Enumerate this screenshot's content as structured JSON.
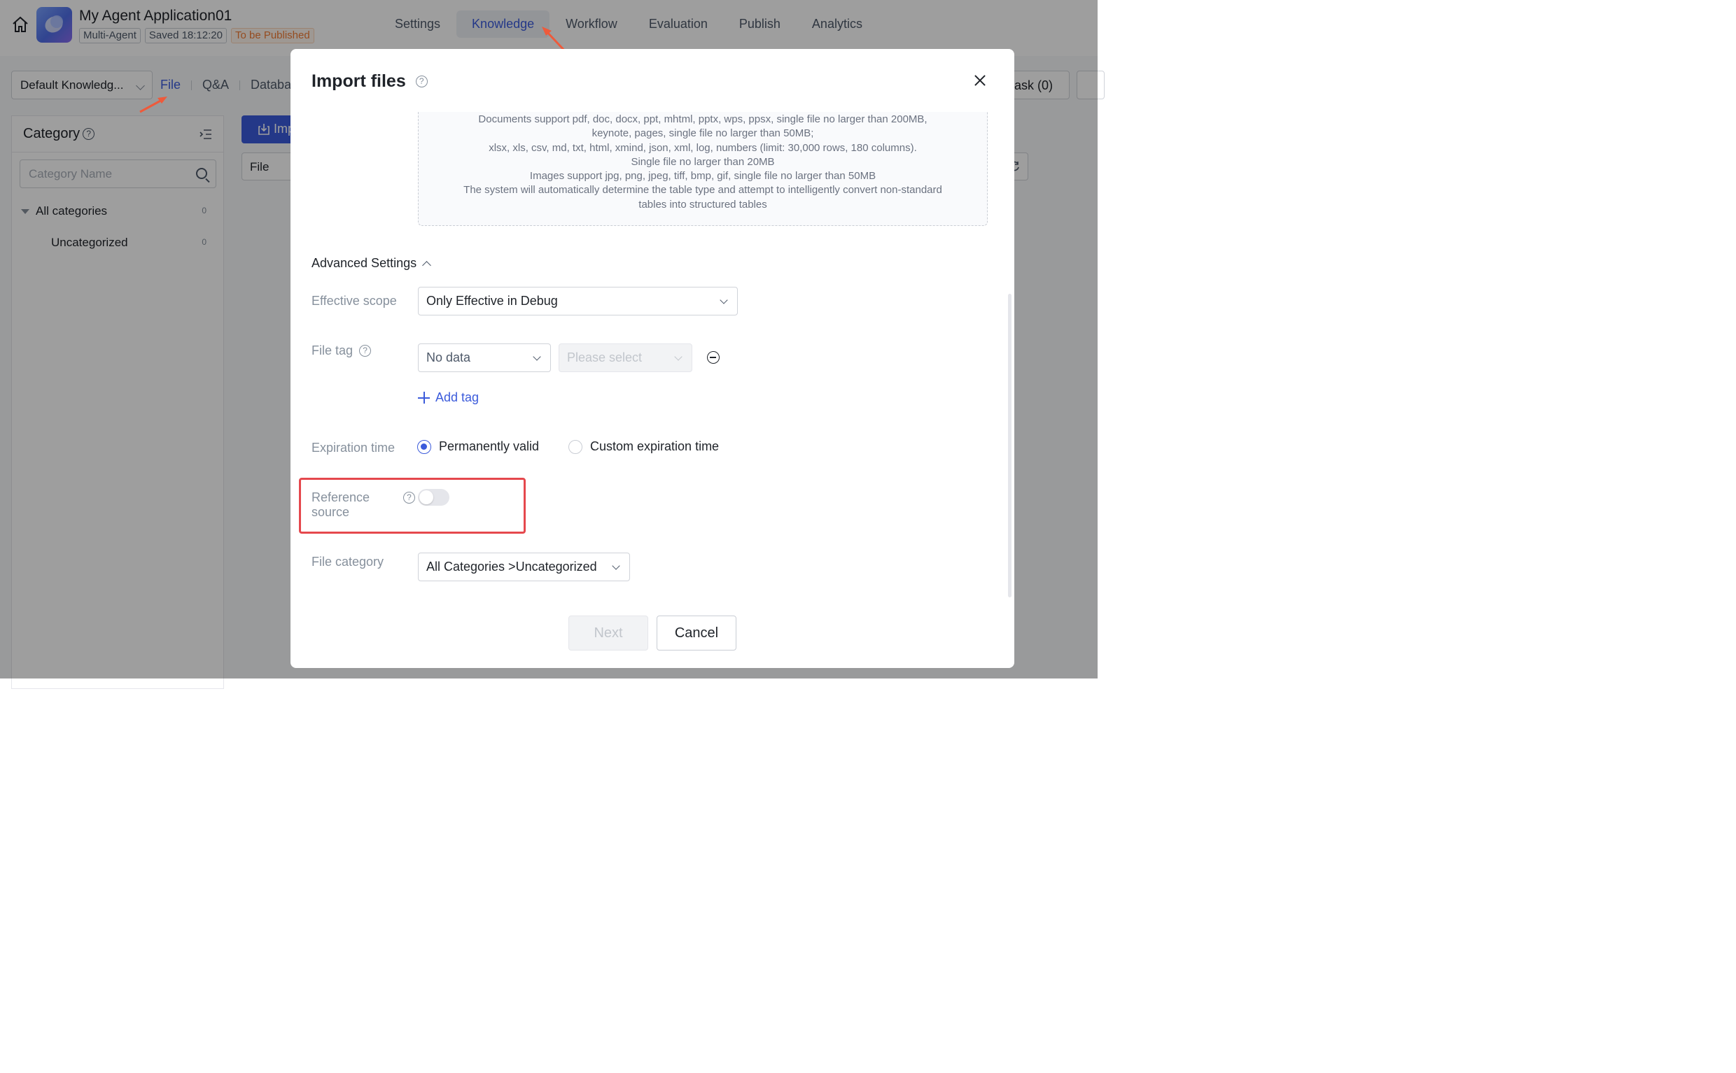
{
  "header": {
    "app_title": "My Agent Application01",
    "tags": [
      "Multi-Agent",
      "Saved 18:12:20",
      "To be Published"
    ],
    "nav": [
      "Settings",
      "Knowledge",
      "Workflow",
      "Evaluation",
      "Publish",
      "Analytics"
    ],
    "active_nav": "Knowledge"
  },
  "kb_bar": {
    "selector_value": "Default Knowledg...",
    "tabs": [
      "File",
      "Q&A",
      "Databa"
    ],
    "task_label": "ask (0)"
  },
  "category_panel": {
    "title": "Category",
    "search_placeholder": "Category Name",
    "items": [
      {
        "label": "All categories",
        "count": "0"
      },
      {
        "label": "Uncategorized",
        "count": "0"
      }
    ]
  },
  "main": {
    "import_label": "Imp",
    "filter_label": "File"
  },
  "modal": {
    "title": "Import files",
    "upload_hint_lines": [
      "Documents support pdf, doc, docx, ppt, mhtml, pptx, wps, ppsx, single file no larger than 200MB,",
      "keynote, pages, single file no larger than 50MB;",
      "xlsx, xls, csv, md, txt, html, xmind, json, xml, log, numbers (limit: 30,000 rows, 180 columns).",
      "Single file no larger than 20MB",
      "Images support jpg, png, jpeg, tiff, bmp, gif, single file no larger than 50MB",
      "The system will automatically determine the table type and attempt to intelligently convert non-standard",
      "tables into structured tables"
    ],
    "advanced_settings": "Advanced Settings",
    "effective_scope": {
      "label": "Effective scope",
      "value": "Only Effective in Debug"
    },
    "file_tag": {
      "label": "File tag",
      "key_value": "No data",
      "value_placeholder": "Please select",
      "add_label": "Add tag"
    },
    "expiration_time": {
      "label": "Expiration time",
      "options": [
        "Permanently valid",
        "Custom expiration time"
      ],
      "selected": "Permanently valid"
    },
    "reference_source": {
      "label_line1": "Reference",
      "label_line2": "source",
      "enabled": false
    },
    "file_category": {
      "label": "File category",
      "value": "All Categories >Uncategorized"
    },
    "buttons": {
      "next": "Next",
      "cancel": "Cancel"
    }
  },
  "colors": {
    "accent": "#3b5bdb",
    "highlight": "#e5484d",
    "annotation_arrow": "#ee5a3b"
  }
}
